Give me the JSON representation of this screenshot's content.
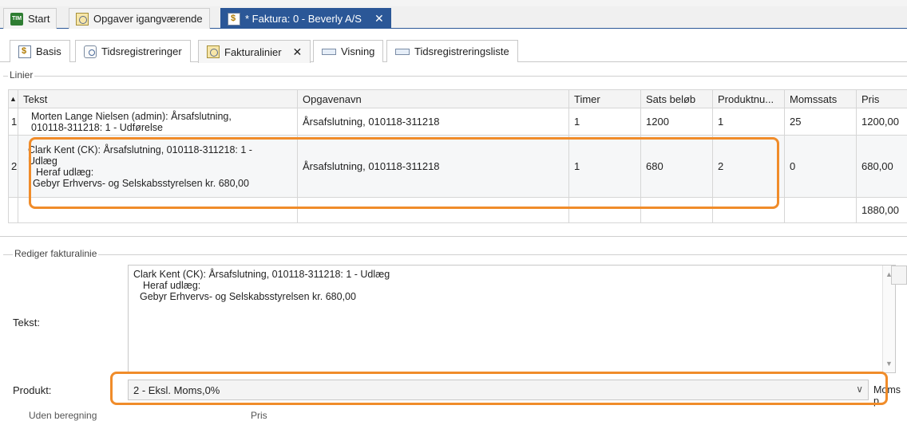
{
  "outer_tabs": [
    {
      "label": "Start",
      "icon": "tim-logo-icon"
    },
    {
      "label": "Opgaver igangværende",
      "icon": "task-icon"
    },
    {
      "label": "* Faktura: 0 - Beverly A/S",
      "icon": "invoice-icon"
    }
  ],
  "inner_tabs": [
    {
      "label": "Basis",
      "icon": "invoice-icon"
    },
    {
      "label": "Tidsregistreringer",
      "icon": "clock-icon"
    },
    {
      "label": "Fakturalinier",
      "icon": "task-icon"
    },
    {
      "label": "Visning",
      "icon": "list-icon"
    },
    {
      "label": "Tidsregistreringsliste",
      "icon": "list-icon"
    }
  ],
  "linier": {
    "group_label": "Linier",
    "columns": [
      "Tekst",
      "Opgavenavn",
      "Timer",
      "Sats beløb",
      "Produktnu...",
      "Momssats",
      "Pris"
    ],
    "rows": [
      {
        "num": "1",
        "tekst": [
          "Morten Lange Nielsen (admin): Årsafslutning,",
          "010118-311218: 1 - Udførelse"
        ],
        "opgavenavn": "Årsafslutning, 010118-311218",
        "timer": "1",
        "sats": "1200",
        "produkt": "1",
        "moms": "25",
        "pris": "1200,00"
      },
      {
        "num": "2",
        "tekst": [
          "Clark Kent (CK): Årsafslutning, 010118-311218: 1 -",
          "Udlæg",
          "Heraf udlæg:",
          "Gebyr Erhvervs- og Selskabsstyrelsen kr. 680,00"
        ],
        "opgavenavn": "Årsafslutning, 010118-311218",
        "timer": "1",
        "sats": "680",
        "produkt": "2",
        "moms": "0",
        "pris": "680,00"
      }
    ],
    "total": "1880,00"
  },
  "rediger": {
    "group_label": "Rediger fakturalinie",
    "tekst_label": "Tekst:",
    "tekst_lines": [
      "Clark Kent (CK): Årsafslutning, 010118-311218: 1 - Udlæg",
      "Heraf udlæg:",
      "Gebyr Erhvervs- og Selskabsstyrelsen kr. 680,00"
    ],
    "produkt_label": "Produkt:",
    "produkt_value": "2 - Eksl. Moms,0%",
    "moms_cut_label": "Moms p",
    "bottom_left": "Uden beregning",
    "bottom_mid": "Pris"
  },
  "colors": {
    "accent": "#2b5797",
    "highlight": "#f08c2a"
  }
}
